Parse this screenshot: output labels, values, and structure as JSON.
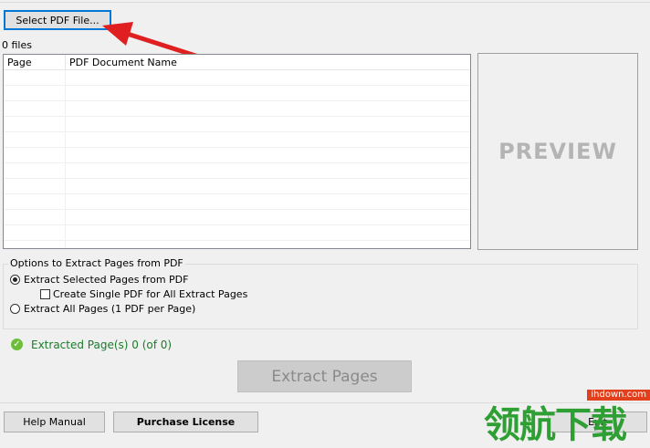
{
  "toolbar": {
    "select_label": "Select PDF File..."
  },
  "files": {
    "count_text": "0 files"
  },
  "list": {
    "columns": [
      "Page",
      "PDF Document Name"
    ]
  },
  "preview": {
    "label": "PREVIEW"
  },
  "options": {
    "title": "Options to Extract Pages from PDF",
    "radio_selected": "Extract Selected Pages from PDF",
    "checkbox_single": "Create Single PDF for All Extract Pages",
    "radio_all": "Extract All Pages (1 PDF per Page)"
  },
  "status": {
    "text": "Extracted Page(s) 0 (of 0)"
  },
  "actions": {
    "extract_label": "Extract Pages",
    "help_label": "Help Manual",
    "purchase_label": "Purchase License",
    "exit_label": "Exit"
  },
  "watermark": {
    "site": "ihdown.com",
    "text": "领航下载"
  },
  "colors": {
    "accent_focus": "#0078d7",
    "status_green": "#1a7b2a",
    "arrow_red": "#e02020"
  }
}
